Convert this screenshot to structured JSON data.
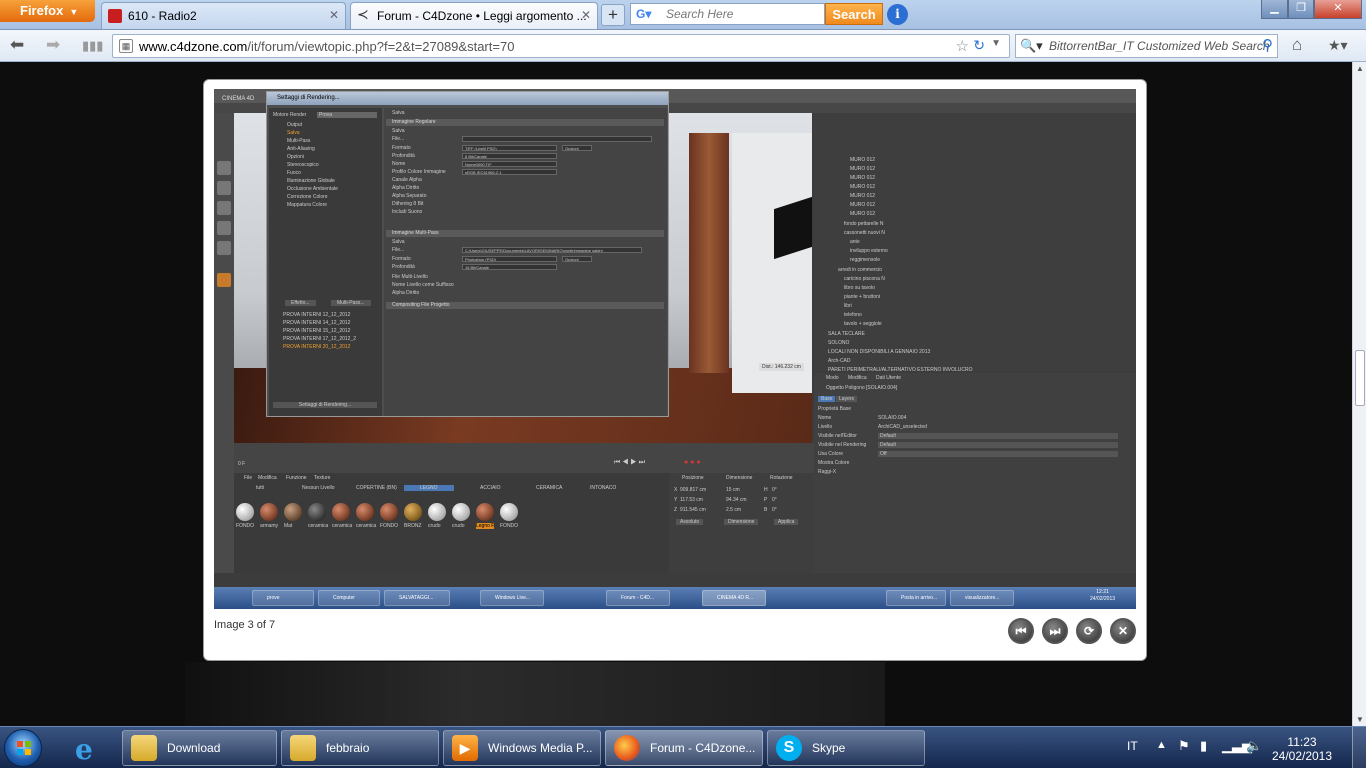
{
  "browser": {
    "menu_button": "Firefox",
    "tabs": [
      {
        "label": "610 - Radio2"
      },
      {
        "label": "Forum - C4Dzone • Leggi argomento ..."
      }
    ],
    "search_placeholder": "Search Here",
    "search_button": "Search",
    "url_domain": "www.c4dzone.com",
    "url_path": "/it/forum/viewtopic.php?f=2&t=27089&start=70",
    "web_search_placeholder": "BittorrentBar_IT Customized Web Search"
  },
  "lightbox": {
    "counter": "Image 3 of 7"
  },
  "c4d": {
    "title": "CINEMA 4D",
    "dialog_title": "Settaggi di Rendering...",
    "renderer_label": "Motore Render",
    "renderer_value": "Prova",
    "left_items": [
      "Output",
      "Salva",
      "Multi-Pass",
      "Anti-Aliasing",
      "Opzioni",
      "Stereoscopico",
      "Fuoco",
      "Illuminazione Globale",
      "Occlusione Ambientale",
      "Correzione Colore",
      "Mappatura Colore"
    ],
    "presets": [
      "PROVA INTERNI 12_12_2012",
      "PROVA INTERNI 14_12_2012",
      "PROVA INTERNI 15_12_2012",
      "PROVA INTERNI 17_12_2012_2",
      "PROVA INTERNI 20_12_2012"
    ],
    "buttons": {
      "effect": "Effetto...",
      "multipass": "Multi-Pass...",
      "settings": "Settaggi di Rendering..."
    },
    "right_header": "Salva",
    "sec_image": "Immagine Regolare",
    "sec_multipass": "Immagine Multi-Pass",
    "sec_compositing": "Compositing File Progetto",
    "fields": [
      {
        "label": "Salva",
        "value": ""
      },
      {
        "label": "File...",
        "value": ""
      },
      {
        "label": "Formato",
        "value": "TIFF (Livelli PSD)"
      },
      {
        "label": "Profondità",
        "value": "8 Bit/Canale"
      },
      {
        "label": "Nome",
        "value": "Nome0000.TIF"
      },
      {
        "label": "Profilo Colore Immagine",
        "value": "sRGB IEC61966-2.1"
      },
      {
        "label": "Canale Alpha",
        "value": ""
      },
      {
        "label": "Alpha Diritto",
        "value": ""
      },
      {
        "label": "Alpha Separato",
        "value": ""
      },
      {
        "label": "Dithering 8 Bit",
        "value": ""
      },
      {
        "label": "Includi Suono",
        "value": ""
      }
    ],
    "mp_fields": [
      {
        "label": "Salva",
        "value": ""
      },
      {
        "label": "File...",
        "value": "C:\\Users\\GIUSEPPE\\Documents\\LAVORI\\SEMINARIO\\pontirimmagine sabini"
      },
      {
        "label": "Formato",
        "value": "Photoshop (PSD)"
      },
      {
        "label": "Profondità",
        "value": "16 Bit/Canale"
      },
      {
        "label": "File Multi-Livello",
        "value": ""
      },
      {
        "label": "Nome Livello come Suffisso",
        "value": ""
      },
      {
        "label": "Alpha Diritto",
        "value": ""
      }
    ],
    "options_label": "Opzioni",
    "tree": [
      "MURO 012",
      "MURO 012",
      "MURO 012",
      "MURO 012",
      "MURO 012",
      "MURO 012",
      "MURO 012",
      "fondo pettarelle N",
      "cassonetti nuovi N",
      "ante",
      "inviluppo esterno",
      "reggimensole",
      "arredi in commercio",
      "caricino piscona N",
      "libro su tavolo",
      "piante + bruttoni",
      "libri",
      "telefono",
      "tavolo + seggiole",
      "SALA TECLARE",
      "SOLONO",
      "LOCALI NON DISPONIBILI A GENNAIO 2013",
      "Arch-CAD",
      "PARETI PERIMETRALI/ALTERNATIVO ESTERNO INVOLUCRO"
    ],
    "attr_menu": [
      "Modo",
      "Modifica",
      "Dati Utente"
    ],
    "attr_object": "Oggetto Poligono [SOLAIO.004]",
    "attr_tabs": [
      "Base",
      "Layers"
    ],
    "attr_section": "Proprietà Base",
    "attr_rows": [
      {
        "label": "Nome",
        "value": "SOLAIO.004"
      },
      {
        "label": "Livello",
        "value": "ArchiCAD_unselected"
      },
      {
        "label": "Visibile nell'Editor",
        "value": "Default"
      },
      {
        "label": "Visibile nel Rendering",
        "value": "Default"
      },
      {
        "label": "Usa Colore",
        "value": "Off"
      },
      {
        "label": "Mostra Colore",
        "value": ""
      },
      {
        "label": "Raggi-X",
        "value": ""
      }
    ],
    "materials_menu": [
      "File",
      "Modifica",
      "Funzione",
      "Texture"
    ],
    "material_tabs": [
      "tutti",
      "Nessun Livello",
      "COPERTINE (BN)",
      "LEGNO",
      "ACCIAIO",
      "CERAMICA",
      "INTONACO"
    ],
    "materials": [
      "FONDO",
      "armamy",
      "Mat",
      "ceramica",
      "ceramica",
      "ceramica",
      "FONDO",
      "BRONZ",
      "crudo",
      "crudo",
      "Legno F",
      "FONDO"
    ],
    "coords_headers": [
      "Posizione",
      "Dimensione",
      "Rotazione"
    ],
    "coords": [
      [
        "X",
        "909.817 cm",
        "15 cm",
        "H",
        "0°"
      ],
      [
        "Y",
        "117.53 cm",
        "94.34 cm",
        "P",
        "0°"
      ],
      [
        "Z",
        "911.545 cm",
        "2.5 cm",
        "B",
        "0°"
      ]
    ],
    "coords_buttons": [
      "Assoluto",
      "Dimensione",
      "Applica"
    ],
    "distance_label": "Dist.: 146.232 cm",
    "frame_value": "0 F",
    "taskbar_items": [
      "prove",
      "Computer",
      "SALVATAGGI...",
      "",
      "Windows Live...",
      "",
      "",
      "Forum - C4D...",
      "",
      "CINEMA 4D R...",
      "",
      "",
      "",
      "",
      "Posta in arrivo...",
      "visualizzatore..."
    ],
    "time": "12:21",
    "date": "24/02/2013"
  },
  "taskbar": {
    "items": [
      {
        "label": "Download"
      },
      {
        "label": "febbraio"
      },
      {
        "label": "Windows Media P..."
      },
      {
        "label": "Forum - C4Dzone..."
      },
      {
        "label": "Skype"
      }
    ],
    "language": "IT",
    "time": "11:23",
    "date": "24/02/2013"
  }
}
